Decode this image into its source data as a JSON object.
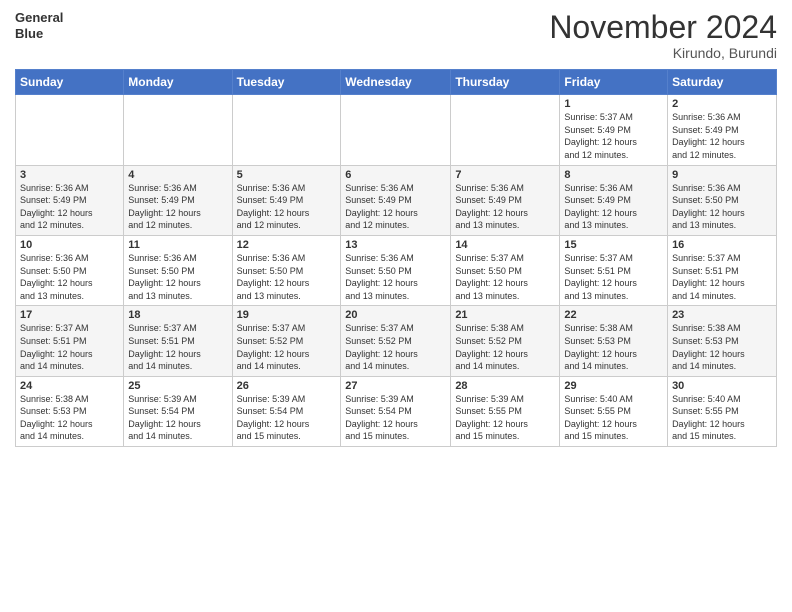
{
  "logo": {
    "line1": "General",
    "line2": "Blue"
  },
  "header": {
    "month": "November 2024",
    "location": "Kirundo, Burundi"
  },
  "weekdays": [
    "Sunday",
    "Monday",
    "Tuesday",
    "Wednesday",
    "Thursday",
    "Friday",
    "Saturday"
  ],
  "weeks": [
    [
      {
        "day": "",
        "info": ""
      },
      {
        "day": "",
        "info": ""
      },
      {
        "day": "",
        "info": ""
      },
      {
        "day": "",
        "info": ""
      },
      {
        "day": "",
        "info": ""
      },
      {
        "day": "1",
        "info": "Sunrise: 5:37 AM\nSunset: 5:49 PM\nDaylight: 12 hours\nand 12 minutes."
      },
      {
        "day": "2",
        "info": "Sunrise: 5:36 AM\nSunset: 5:49 PM\nDaylight: 12 hours\nand 12 minutes."
      }
    ],
    [
      {
        "day": "3",
        "info": "Sunrise: 5:36 AM\nSunset: 5:49 PM\nDaylight: 12 hours\nand 12 minutes."
      },
      {
        "day": "4",
        "info": "Sunrise: 5:36 AM\nSunset: 5:49 PM\nDaylight: 12 hours\nand 12 minutes."
      },
      {
        "day": "5",
        "info": "Sunrise: 5:36 AM\nSunset: 5:49 PM\nDaylight: 12 hours\nand 12 minutes."
      },
      {
        "day": "6",
        "info": "Sunrise: 5:36 AM\nSunset: 5:49 PM\nDaylight: 12 hours\nand 12 minutes."
      },
      {
        "day": "7",
        "info": "Sunrise: 5:36 AM\nSunset: 5:49 PM\nDaylight: 12 hours\nand 13 minutes."
      },
      {
        "day": "8",
        "info": "Sunrise: 5:36 AM\nSunset: 5:49 PM\nDaylight: 12 hours\nand 13 minutes."
      },
      {
        "day": "9",
        "info": "Sunrise: 5:36 AM\nSunset: 5:50 PM\nDaylight: 12 hours\nand 13 minutes."
      }
    ],
    [
      {
        "day": "10",
        "info": "Sunrise: 5:36 AM\nSunset: 5:50 PM\nDaylight: 12 hours\nand 13 minutes."
      },
      {
        "day": "11",
        "info": "Sunrise: 5:36 AM\nSunset: 5:50 PM\nDaylight: 12 hours\nand 13 minutes."
      },
      {
        "day": "12",
        "info": "Sunrise: 5:36 AM\nSunset: 5:50 PM\nDaylight: 12 hours\nand 13 minutes."
      },
      {
        "day": "13",
        "info": "Sunrise: 5:36 AM\nSunset: 5:50 PM\nDaylight: 12 hours\nand 13 minutes."
      },
      {
        "day": "14",
        "info": "Sunrise: 5:37 AM\nSunset: 5:50 PM\nDaylight: 12 hours\nand 13 minutes."
      },
      {
        "day": "15",
        "info": "Sunrise: 5:37 AM\nSunset: 5:51 PM\nDaylight: 12 hours\nand 13 minutes."
      },
      {
        "day": "16",
        "info": "Sunrise: 5:37 AM\nSunset: 5:51 PM\nDaylight: 12 hours\nand 14 minutes."
      }
    ],
    [
      {
        "day": "17",
        "info": "Sunrise: 5:37 AM\nSunset: 5:51 PM\nDaylight: 12 hours\nand 14 minutes."
      },
      {
        "day": "18",
        "info": "Sunrise: 5:37 AM\nSunset: 5:51 PM\nDaylight: 12 hours\nand 14 minutes."
      },
      {
        "day": "19",
        "info": "Sunrise: 5:37 AM\nSunset: 5:52 PM\nDaylight: 12 hours\nand 14 minutes."
      },
      {
        "day": "20",
        "info": "Sunrise: 5:37 AM\nSunset: 5:52 PM\nDaylight: 12 hours\nand 14 minutes."
      },
      {
        "day": "21",
        "info": "Sunrise: 5:38 AM\nSunset: 5:52 PM\nDaylight: 12 hours\nand 14 minutes."
      },
      {
        "day": "22",
        "info": "Sunrise: 5:38 AM\nSunset: 5:53 PM\nDaylight: 12 hours\nand 14 minutes."
      },
      {
        "day": "23",
        "info": "Sunrise: 5:38 AM\nSunset: 5:53 PM\nDaylight: 12 hours\nand 14 minutes."
      }
    ],
    [
      {
        "day": "24",
        "info": "Sunrise: 5:38 AM\nSunset: 5:53 PM\nDaylight: 12 hours\nand 14 minutes."
      },
      {
        "day": "25",
        "info": "Sunrise: 5:39 AM\nSunset: 5:54 PM\nDaylight: 12 hours\nand 14 minutes."
      },
      {
        "day": "26",
        "info": "Sunrise: 5:39 AM\nSunset: 5:54 PM\nDaylight: 12 hours\nand 15 minutes."
      },
      {
        "day": "27",
        "info": "Sunrise: 5:39 AM\nSunset: 5:54 PM\nDaylight: 12 hours\nand 15 minutes."
      },
      {
        "day": "28",
        "info": "Sunrise: 5:39 AM\nSunset: 5:55 PM\nDaylight: 12 hours\nand 15 minutes."
      },
      {
        "day": "29",
        "info": "Sunrise: 5:40 AM\nSunset: 5:55 PM\nDaylight: 12 hours\nand 15 minutes."
      },
      {
        "day": "30",
        "info": "Sunrise: 5:40 AM\nSunset: 5:55 PM\nDaylight: 12 hours\nand 15 minutes."
      }
    ]
  ]
}
